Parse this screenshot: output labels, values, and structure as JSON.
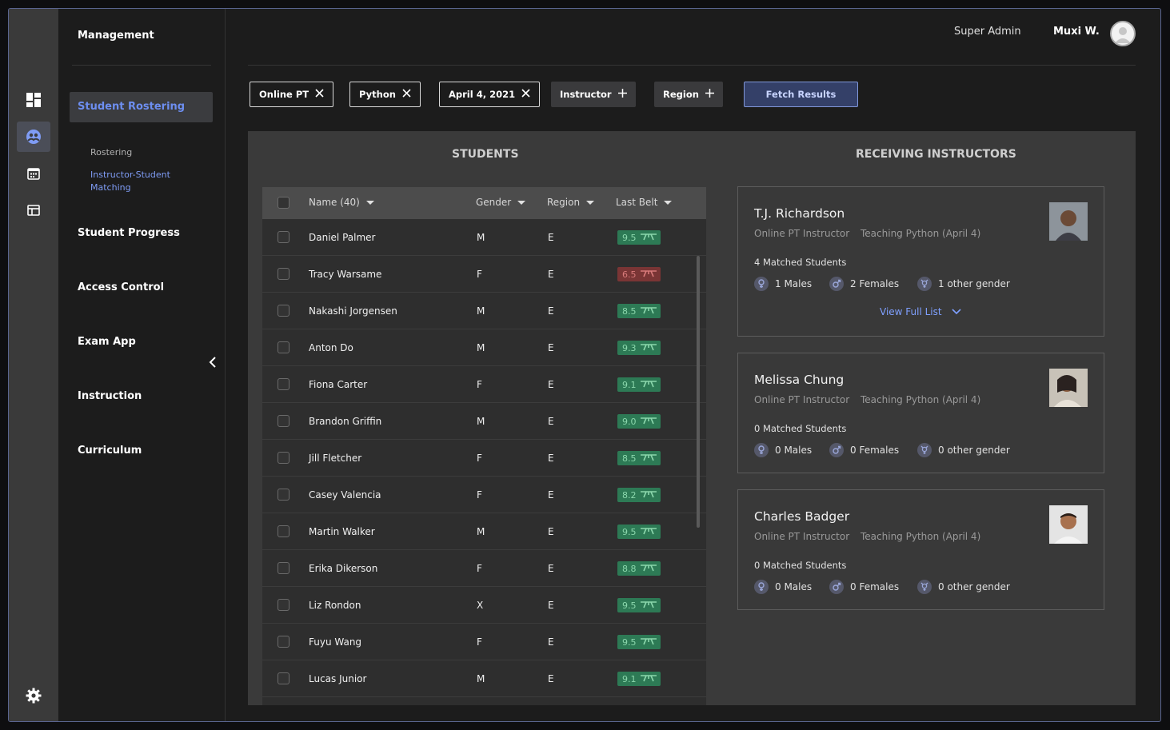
{
  "sidebar": {
    "title": "Management",
    "active_section": "Student Rostering",
    "sub_items": [
      "Rostering",
      "Instructor-Student",
      "Matching"
    ],
    "sections": [
      "Student Progress",
      "Access Control",
      "Exam App",
      "Instruction",
      "Curriculum"
    ]
  },
  "header": {
    "role": "Super Admin",
    "user_name": "Muxi W."
  },
  "filters": {
    "chips": [
      "Online PT",
      "Python",
      "April 4, 2021"
    ],
    "add_chips": [
      "Instructor",
      "Region"
    ],
    "fetch_label": "Fetch Results"
  },
  "students": {
    "heading": "STUDENTS",
    "columns": {
      "name": "Name (40)",
      "gender": "Gender",
      "region": "Region",
      "belt": "Last Belt"
    },
    "rows": [
      {
        "name": "Daniel Palmer",
        "gender": "M",
        "region": "E",
        "belt": "9.5",
        "belt_status": "green"
      },
      {
        "name": "Tracy Warsame",
        "gender": "F",
        "region": "E",
        "belt": "6.5",
        "belt_status": "red"
      },
      {
        "name": "Nakashi Jorgensen",
        "gender": "M",
        "region": "E",
        "belt": "8.5",
        "belt_status": "green"
      },
      {
        "name": "Anton Do",
        "gender": "M",
        "region": "E",
        "belt": "9.3",
        "belt_status": "green"
      },
      {
        "name": "Fiona Carter",
        "gender": "F",
        "region": "E",
        "belt": "9.1",
        "belt_status": "green"
      },
      {
        "name": "Brandon Griffin",
        "gender": "M",
        "region": "E",
        "belt": "9.0",
        "belt_status": "green"
      },
      {
        "name": "Jill Fletcher",
        "gender": "F",
        "region": "E",
        "belt": "8.5",
        "belt_status": "green"
      },
      {
        "name": "Casey Valencia",
        "gender": "F",
        "region": "E",
        "belt": "8.2",
        "belt_status": "green"
      },
      {
        "name": "Martin Walker",
        "gender": "M",
        "region": "E",
        "belt": "9.5",
        "belt_status": "green"
      },
      {
        "name": "Erika Dikerson",
        "gender": "F",
        "region": "E",
        "belt": "8.8",
        "belt_status": "green"
      },
      {
        "name": "Liz Rondon",
        "gender": "X",
        "region": "E",
        "belt": "9.5",
        "belt_status": "green"
      },
      {
        "name": "Fuyu Wang",
        "gender": "F",
        "region": "E",
        "belt": "9.5",
        "belt_status": "green"
      },
      {
        "name": "Lucas Junior",
        "gender": "M",
        "region": "E",
        "belt": "9.1",
        "belt_status": "green"
      }
    ]
  },
  "instructors": {
    "heading": "RECEIVING INSTRUCTORS",
    "cards": [
      {
        "name": "T.J. Richardson",
        "role": "Online PT Instructor",
        "teaching": "Teaching Python (April 4)",
        "matched": "4 Matched Students",
        "males": "1 Males",
        "females": "2 Females",
        "other": "1 other gender",
        "view_list": "View Full List"
      },
      {
        "name": "Melissa Chung",
        "role": "Online PT Instructor",
        "teaching": "Teaching Python (April 4)",
        "matched": "0 Matched Students",
        "males": "0 Males",
        "females": "0 Females",
        "other": "0 other gender"
      },
      {
        "name": "Charles Badger",
        "role": "Online PT Instructor",
        "teaching": "Teaching Python (April 4)",
        "matched": "0 Matched Students",
        "males": "0 Males",
        "females": "0 Females",
        "other": "0 other gender"
      }
    ]
  },
  "colors": {
    "accent": "#6d8ef0",
    "belt_green": "#2d7a55",
    "belt_red": "#7a3535",
    "fetch_bg": "#344068"
  }
}
